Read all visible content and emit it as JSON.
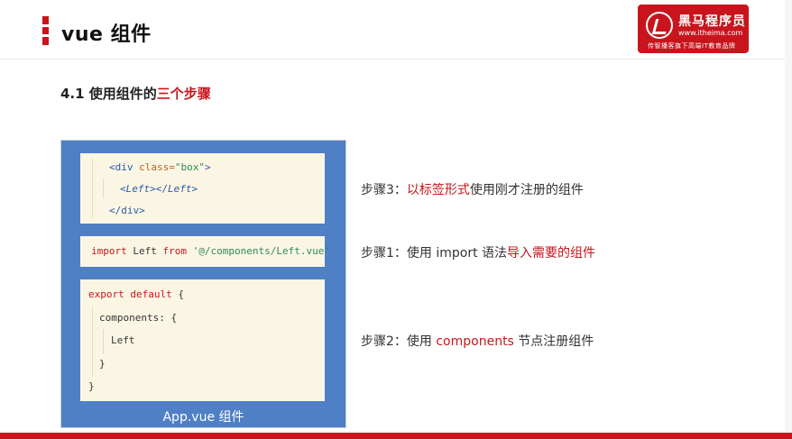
{
  "header": {
    "title": "vue 组件",
    "logo": {
      "name": "黑马程序员",
      "url": "www.itheima.com",
      "slogan": "传智播客旗下高端IT教育品牌"
    }
  },
  "subtitle": {
    "prefix": "4.1 使用组件的",
    "highlight": "三个步骤"
  },
  "code_panel": {
    "caption": "App.vue 组件",
    "template_block": {
      "l1_open": "<div ",
      "l1_attr": "class=",
      "l1_val": "\"box\"",
      "l1_close": ">",
      "l2_open": "<",
      "l2_comp": "Left",
      "l2_mid": "></",
      "l2_comp2": "Left",
      "l2_close": ">",
      "l3": "</div>"
    },
    "import_block": {
      "kw_import": "import",
      "name": " Left ",
      "kw_from": "from",
      "path": " '@/components/Left.vue'"
    },
    "export_block": {
      "l1_kw": "export default",
      "l1_rest": " {",
      "l2": "components: {",
      "l3": "Left",
      "l4": "}",
      "l5": "}"
    }
  },
  "steps": {
    "step3": {
      "prefix": "步骤3：",
      "highlight": "以标签形式",
      "suffix": "使用刚才注册的组件"
    },
    "step1": {
      "prefix": "步骤1：使用 import 语法",
      "highlight": "导入需要的组件",
      "suffix": ""
    },
    "step2": {
      "prefix": "步骤2：使用 ",
      "highlight": "components",
      "suffix": " 节点注册组件"
    }
  },
  "colors": {
    "brand_red": "#c8151d",
    "panel_blue": "#4f7fc4",
    "code_bg": "#fbf6e4"
  }
}
